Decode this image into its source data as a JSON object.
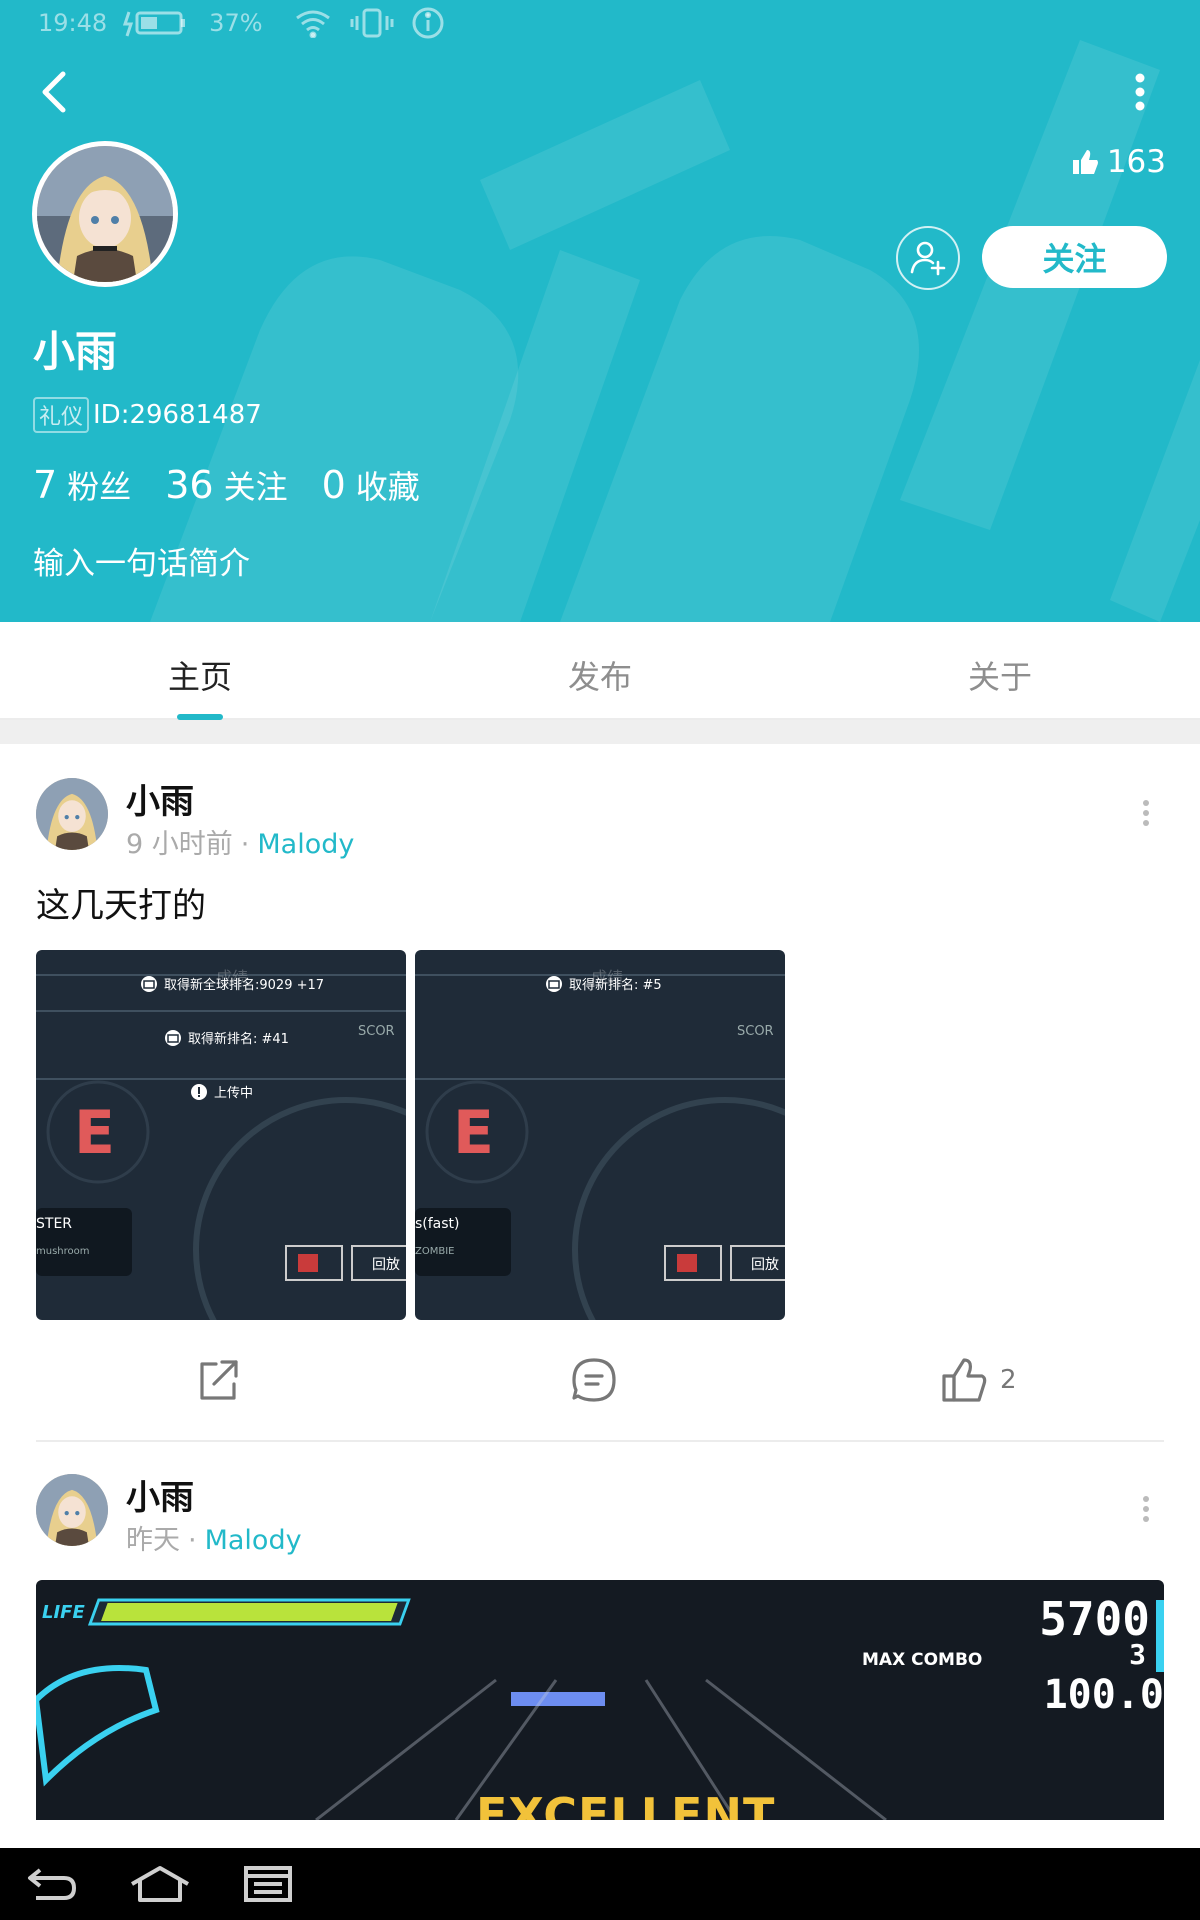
{
  "status_bar": {
    "time": "19:48",
    "battery": "37%"
  },
  "profile": {
    "name": "小雨",
    "badge": "礼仪",
    "id_text": "ID:29681487",
    "likes": "163",
    "follow_label": "关注",
    "bio": "输入一句话简介",
    "stats": [
      {
        "value": "7",
        "label": "粉丝"
      },
      {
        "value": "36",
        "label": "关注"
      },
      {
        "value": "0",
        "label": "收藏"
      }
    ],
    "colors": {
      "primary": "#22b9c9"
    }
  },
  "tabs": [
    {
      "label": "主页",
      "active": true
    },
    {
      "label": "发布",
      "active": false
    },
    {
      "label": "关于",
      "active": false
    }
  ],
  "posts": [
    {
      "author": "小雨",
      "time": "9 小时前",
      "dot": "·",
      "source": "Malody",
      "text": "这几天打的",
      "images": [
        {
          "toast1": "取得新全球排名:9029 +17",
          "toast2": "取得新排名: #41",
          "toast3": "上传中",
          "side_label": "STER",
          "side_sub": "mushroom",
          "btn": "回放",
          "rank": "E",
          "score_tag": "SCOR",
          "ghost": "成绩"
        },
        {
          "toast1": "取得新排名: #5",
          "side_label": "s(fast)",
          "side_sub": "ZOMBIE",
          "btn": "回放",
          "rank": "E",
          "score_tag": "SCOR",
          "ghost": "成绩"
        }
      ],
      "like_count": "2"
    },
    {
      "author": "小雨",
      "time": "昨天",
      "dot": "·",
      "source": "Malody",
      "game": {
        "life": "LIFE",
        "score": "5700",
        "combo": "3",
        "combo_label": "MAX COMBO",
        "acc": "100.0",
        "judge": "EXCELLENT"
      }
    }
  ]
}
